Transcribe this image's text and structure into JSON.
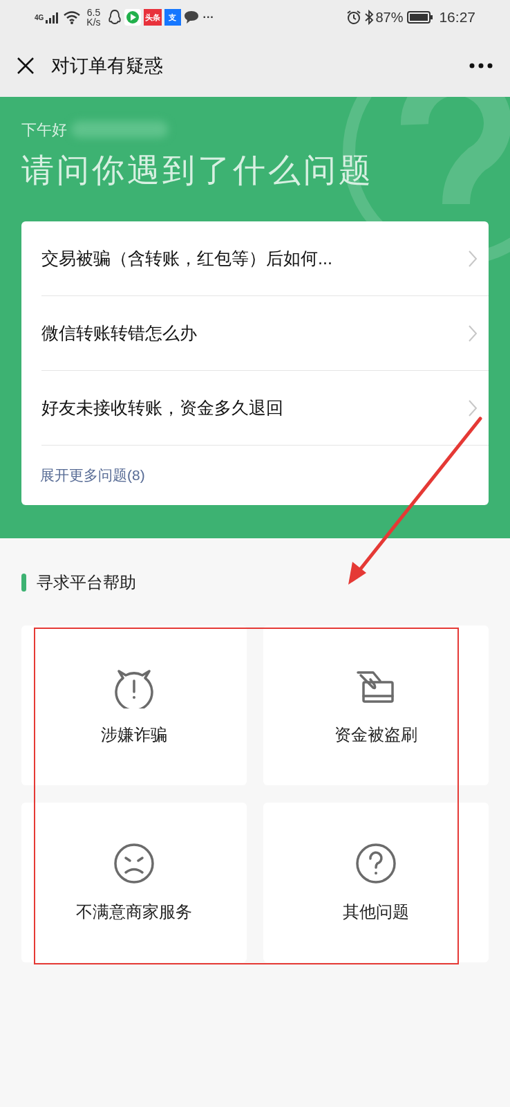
{
  "status_bar": {
    "network": "4G",
    "speed": "6.5",
    "speed_unit": "K/s",
    "app_badges": [
      {
        "label": "头条",
        "color": "#e8323c"
      },
      {
        "label": "支",
        "color": "#1677ff"
      }
    ],
    "more": "···",
    "battery": "87%",
    "time": "16:27"
  },
  "nav_bar": {
    "title": "对订单有疑惑"
  },
  "header": {
    "greeting": "下午好",
    "question": "请问你遇到了什么问题"
  },
  "faq": {
    "items": [
      {
        "text": "交易被骗（含转账，红包等）后如何..."
      },
      {
        "text": "微信转账转错怎么办"
      },
      {
        "text": "好友未接收转账，资金多久退回"
      }
    ],
    "more_link": "展开更多问题(8)"
  },
  "section": {
    "title": "寻求平台帮助"
  },
  "help_options": [
    {
      "kind": "fraud",
      "label": "涉嫌诈骗"
    },
    {
      "kind": "card",
      "label": "资金被盗刷"
    },
    {
      "kind": "sad",
      "label": "不满意商家服务"
    },
    {
      "kind": "question",
      "label": "其他问题"
    }
  ]
}
